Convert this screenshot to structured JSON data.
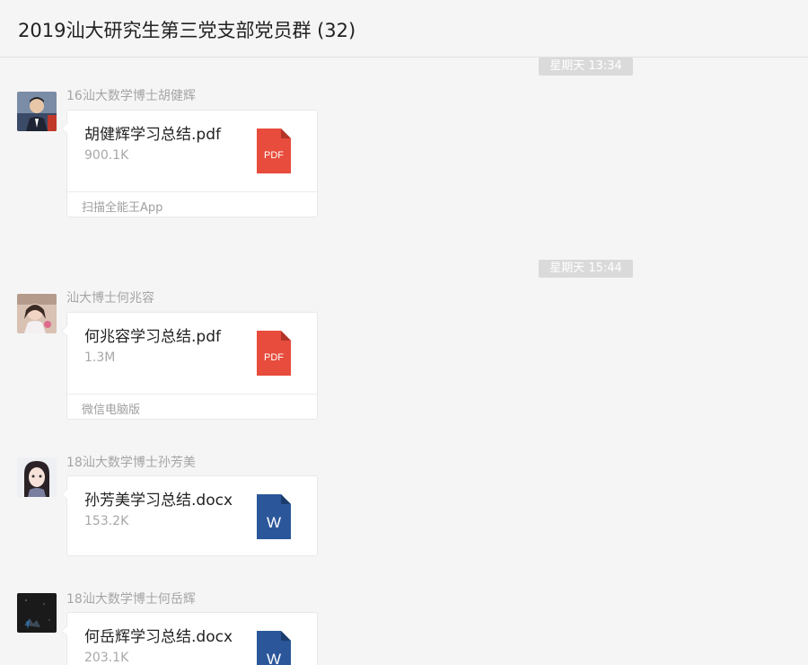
{
  "window": {
    "title": "2019汕大研究生第三党支部党员群 (32)"
  },
  "timestamps": [
    "星期天 13:34",
    "星期天 15:44"
  ],
  "messages": [
    {
      "sender": "16汕大数学博士胡健辉",
      "file_name": "胡健辉学习总结.pdf",
      "file_size": "900.1K",
      "icon": "pdf-icon",
      "icon_label": "PDF",
      "source": "扫描全能王App"
    },
    {
      "sender": "汕大博士何兆容",
      "file_name": "何兆容学习总结.pdf",
      "file_size": "1.3M",
      "icon": "pdf-icon",
      "icon_label": "PDF",
      "source": "微信电脑版"
    },
    {
      "sender": "18汕大数学博士孙芳美",
      "file_name": "孙芳美学习总结.docx",
      "file_size": "153.2K",
      "icon": "word-icon",
      "icon_label": "W"
    },
    {
      "sender": "18汕大数学博士何岳辉",
      "file_name": "何岳辉学习总结.docx",
      "file_size": "203.1K",
      "icon": "word-icon",
      "icon_label": "W"
    }
  ],
  "colors": {
    "pdf": "#e74c3c",
    "word": "#2b579a",
    "background": "#f5f5f5",
    "timestamp_bg": "#dadada"
  }
}
